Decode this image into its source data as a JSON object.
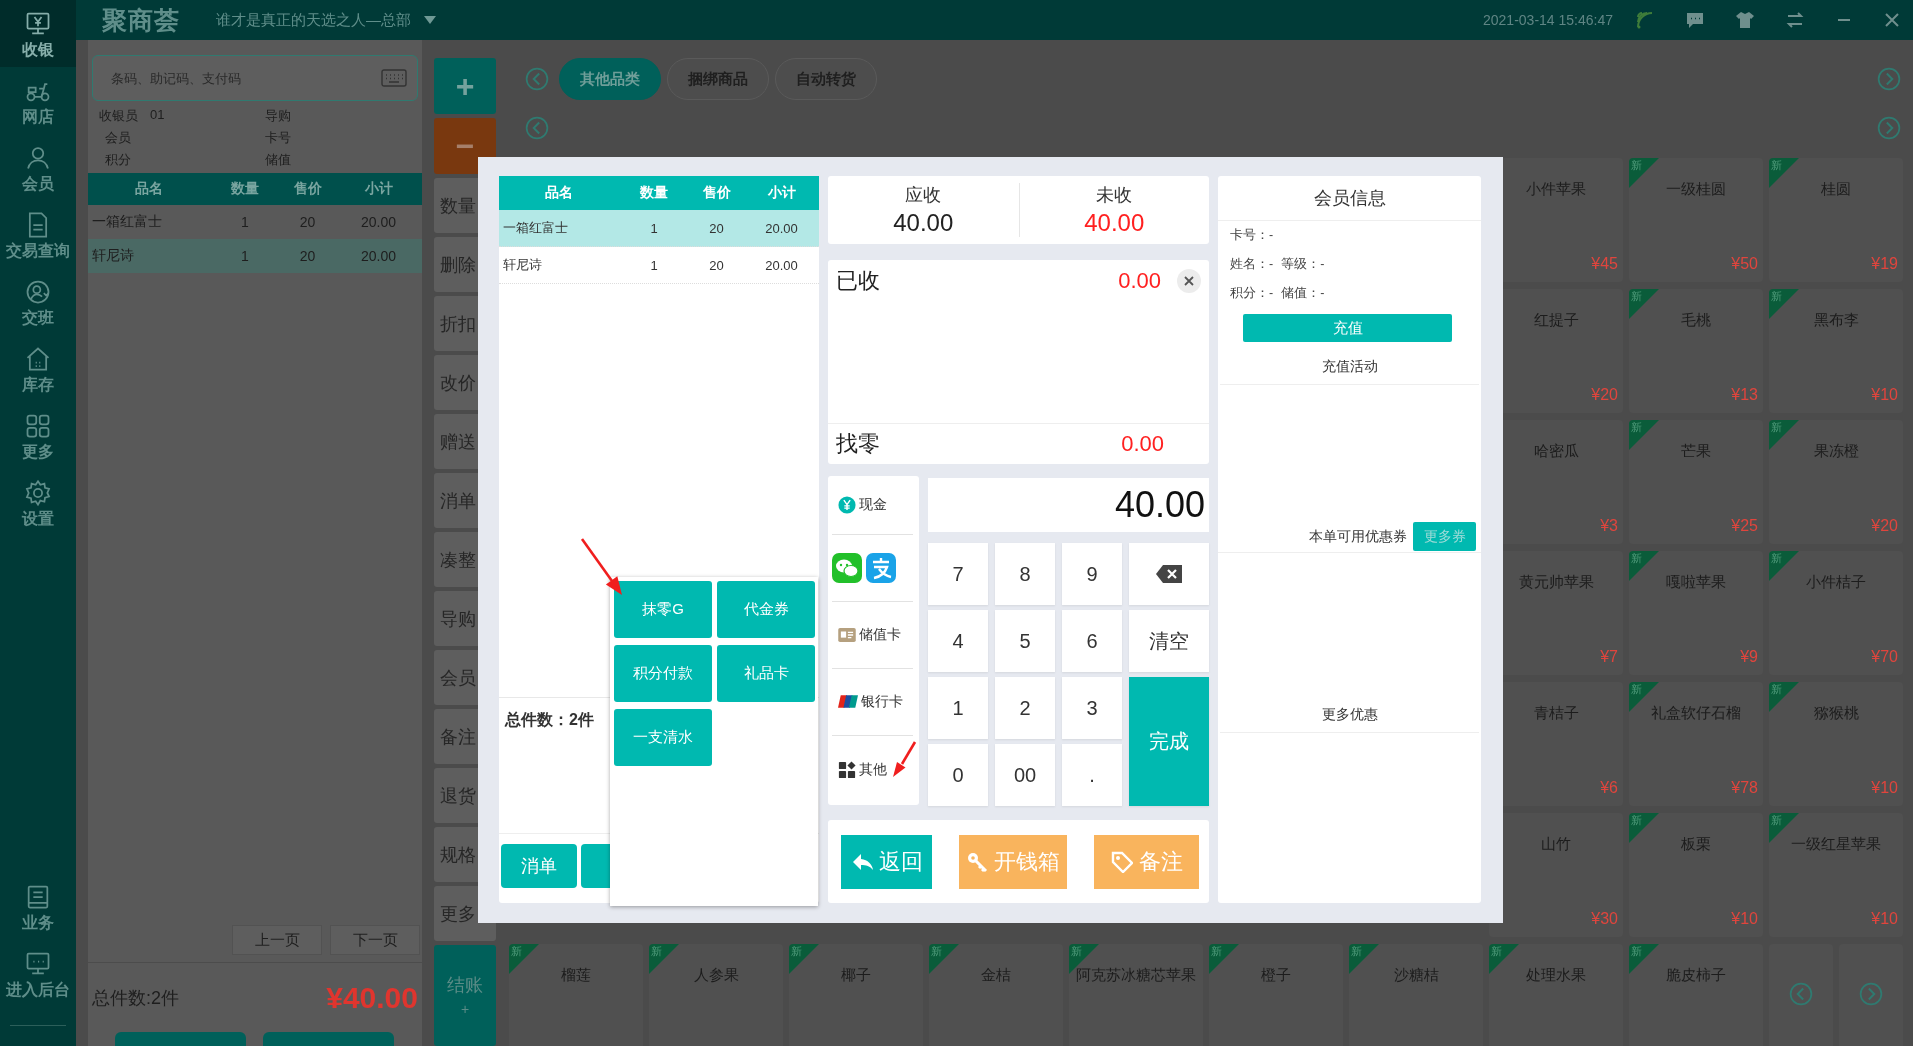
{
  "nav": {
    "items": [
      {
        "label": "收银",
        "kind": "register",
        "selected": true
      },
      {
        "label": "网店",
        "kind": "scooter",
        "selected": false
      },
      {
        "label": "会员",
        "kind": "member",
        "selected": false
      },
      {
        "label": "交易查询",
        "kind": "document",
        "selected": false
      },
      {
        "label": "交班",
        "kind": "shift",
        "selected": false
      },
      {
        "label": "库存",
        "kind": "warehouse",
        "selected": false
      },
      {
        "label": "更多",
        "kind": "apps",
        "selected": false
      },
      {
        "label": "设置",
        "kind": "settings",
        "selected": false
      }
    ],
    "bottom_items": [
      {
        "label": "业务",
        "kind": "book",
        "selected": false
      },
      {
        "label": "进入后台",
        "kind": "backend",
        "selected": false
      }
    ]
  },
  "app_bar": {
    "logo": "聚商荟",
    "store": "谁才是真正的天选之人—总部",
    "datetime": "2021-03-14 15:46:47"
  },
  "cart": {
    "search": {
      "placeholder": "条码、助记码、支付码"
    },
    "info": [
      [
        "收银员",
        "01"
      ],
      [
        "导购"
      ],
      [
        "会员"
      ],
      [
        "卡号"
      ],
      [
        "积分"
      ],
      [
        "储值"
      ]
    ],
    "columns": [
      "品名",
      "数量",
      "售价",
      "小计"
    ],
    "rows": [
      {
        "cells": [
          "一箱红富士",
          "1",
          "20",
          "20.00"
        ],
        "selected": false
      },
      {
        "cells": [
          "轩尼诗",
          "1",
          "20",
          "20.00"
        ],
        "selected": true
      }
    ],
    "pager": [
      "上一页",
      "下一页"
    ],
    "total_count": "总件数:2件",
    "total_amount": "¥40.00"
  },
  "actions": [
    {
      "kind": "add",
      "label": "+"
    },
    {
      "kind": "remove",
      "label": "−"
    },
    {
      "kind": "text",
      "label": "数量"
    },
    {
      "kind": "text",
      "label": "删除"
    },
    {
      "kind": "text",
      "label": "折扣"
    },
    {
      "kind": "text",
      "label": "改价"
    },
    {
      "kind": "text",
      "label": "赠送"
    },
    {
      "kind": "text",
      "label": "消单"
    },
    {
      "kind": "text",
      "label": "凑整"
    },
    {
      "kind": "text",
      "label": "导购"
    },
    {
      "kind": "text",
      "label": "会员"
    },
    {
      "kind": "text",
      "label": "备注"
    },
    {
      "kind": "text",
      "label": "退货"
    },
    {
      "kind": "text",
      "label": "规格"
    },
    {
      "kind": "text",
      "label": "更多"
    },
    {
      "kind": "checkout",
      "label": "结账",
      "sub": "+"
    }
  ],
  "category_tabs": [
    {
      "label": "其他品类",
      "selected": true
    },
    {
      "label": "捆绑商品",
      "selected": false
    },
    {
      "label": "自动转货",
      "selected": false
    }
  ],
  "products": {
    "upper_rows": [
      [
        {
          "name": "小件苹果",
          "price": "¥45"
        },
        {
          "name": "一级桂圆",
          "price": "¥50",
          "badge": "新"
        },
        {
          "name": "桂圆",
          "price": "¥19",
          "badge": "新"
        }
      ],
      [
        {
          "name": "红提子",
          "price": "¥20"
        },
        {
          "name": "毛桃",
          "price": "¥13",
          "badge": "新"
        },
        {
          "name": "黑布李",
          "price": "¥10",
          "badge": "新"
        }
      ],
      [
        {
          "name": "哈密瓜",
          "price": "¥3"
        },
        {
          "name": "芒果",
          "price": "¥25",
          "badge": "新"
        },
        {
          "name": "果冻橙",
          "price": "¥20",
          "badge": "新"
        }
      ],
      [
        {
          "name": "黄元帅苹果",
          "price": "¥7"
        },
        {
          "name": "嘎啦苹果",
          "price": "¥9",
          "badge": "新"
        },
        {
          "name": "小件桔子",
          "price": "¥70",
          "badge": "新"
        }
      ],
      [
        {
          "name": "青桔子",
          "price": "¥6"
        },
        {
          "name": "礼盒软仔石榴",
          "price": "¥78",
          "badge": "新"
        },
        {
          "name": "猕猴桃",
          "price": "¥10",
          "badge": "新"
        }
      ],
      [
        {
          "name": "山竹",
          "price": "¥30"
        },
        {
          "name": "板栗",
          "price": "¥10",
          "badge": "新"
        },
        {
          "name": "一级红星苹果",
          "price": "¥10",
          "badge": "新"
        }
      ]
    ],
    "last_row": [
      {
        "name": "榴莲",
        "badge": "新"
      },
      {
        "name": "人参果",
        "badge": "新"
      },
      {
        "name": "椰子",
        "badge": "新"
      },
      {
        "name": "金桔",
        "badge": "新"
      },
      {
        "name": "阿克苏冰糖芯苹果",
        "badge": "新"
      },
      {
        "name": "橙子",
        "badge": "新"
      },
      {
        "name": "沙糖桔",
        "badge": "新"
      },
      {
        "name": "处理水果",
        "badge": "新"
      },
      {
        "name": "脆皮柿子",
        "badge": "新"
      }
    ]
  },
  "checkout_dialog": {
    "order": {
      "columns": [
        "品名",
        "数量",
        "售价",
        "小计"
      ],
      "rows": [
        {
          "cells": [
            "一箱红富士",
            "1",
            "20",
            "20.00"
          ],
          "selected": true
        },
        {
          "cells": [
            "轩尼诗",
            "1",
            "20",
            "20.00"
          ],
          "selected": false
        }
      ],
      "total_count": "总件数：2件",
      "buttons": [
        {
          "kind": "text",
          "label": "消单"
        },
        {
          "kind": "covered"
        }
      ]
    },
    "summary": [
      {
        "label": "应收",
        "value": "40.00",
        "kind": "due"
      },
      {
        "label": "未收",
        "value": "40.00",
        "kind": "outstanding"
      }
    ],
    "received": {
      "label": "已收",
      "value": "0.00"
    },
    "change": {
      "label": "找零",
      "value": "0.00"
    },
    "payment_methods": [
      {
        "kind": "cash",
        "label": "现金"
      },
      {
        "kind": "qr"
      },
      {
        "kind": "stored_card",
        "label": "储值卡"
      },
      {
        "kind": "bank_card",
        "label": "银行卡"
      },
      {
        "kind": "other",
        "label": "其他"
      }
    ],
    "amount": "40.00",
    "keys": [
      {
        "kind": "digit",
        "label": "7"
      },
      {
        "kind": "digit",
        "label": "8"
      },
      {
        "kind": "digit",
        "label": "9"
      },
      {
        "kind": "backspace"
      },
      {
        "kind": "digit",
        "label": "4"
      },
      {
        "kind": "digit",
        "label": "5"
      },
      {
        "kind": "digit",
        "label": "6"
      },
      {
        "kind": "clear",
        "label": "清空"
      },
      {
        "kind": "digit",
        "label": "1"
      },
      {
        "kind": "digit",
        "label": "2"
      },
      {
        "kind": "digit",
        "label": "3"
      },
      {
        "kind": "confirm",
        "label": "完成"
      },
      {
        "kind": "digit",
        "label": "0"
      },
      {
        "kind": "digit",
        "label": "00"
      },
      {
        "kind": "digit",
        "label": "."
      }
    ],
    "actions": [
      {
        "kind": "back",
        "label": "返回"
      },
      {
        "kind": "cash_drawer",
        "label": "开钱箱"
      },
      {
        "kind": "note",
        "label": "备注"
      }
    ],
    "member": {
      "title": "会员信息",
      "fields": [
        [
          "卡号：-"
        ],
        [
          "姓名：-",
          "等级：-"
        ],
        [
          "积分：-",
          "储值：-"
        ]
      ],
      "recharge_button": "充值",
      "recharge_activities_title": "充值活动",
      "coupons_label": "本单可用优惠券",
      "more_coupons_button": "更多券",
      "more_offers_title": "更多优惠"
    },
    "other_payments_menu": {
      "options": [
        "抹零G",
        "代金券",
        "积分付款",
        "礼品卡",
        "一支清水"
      ]
    }
  }
}
